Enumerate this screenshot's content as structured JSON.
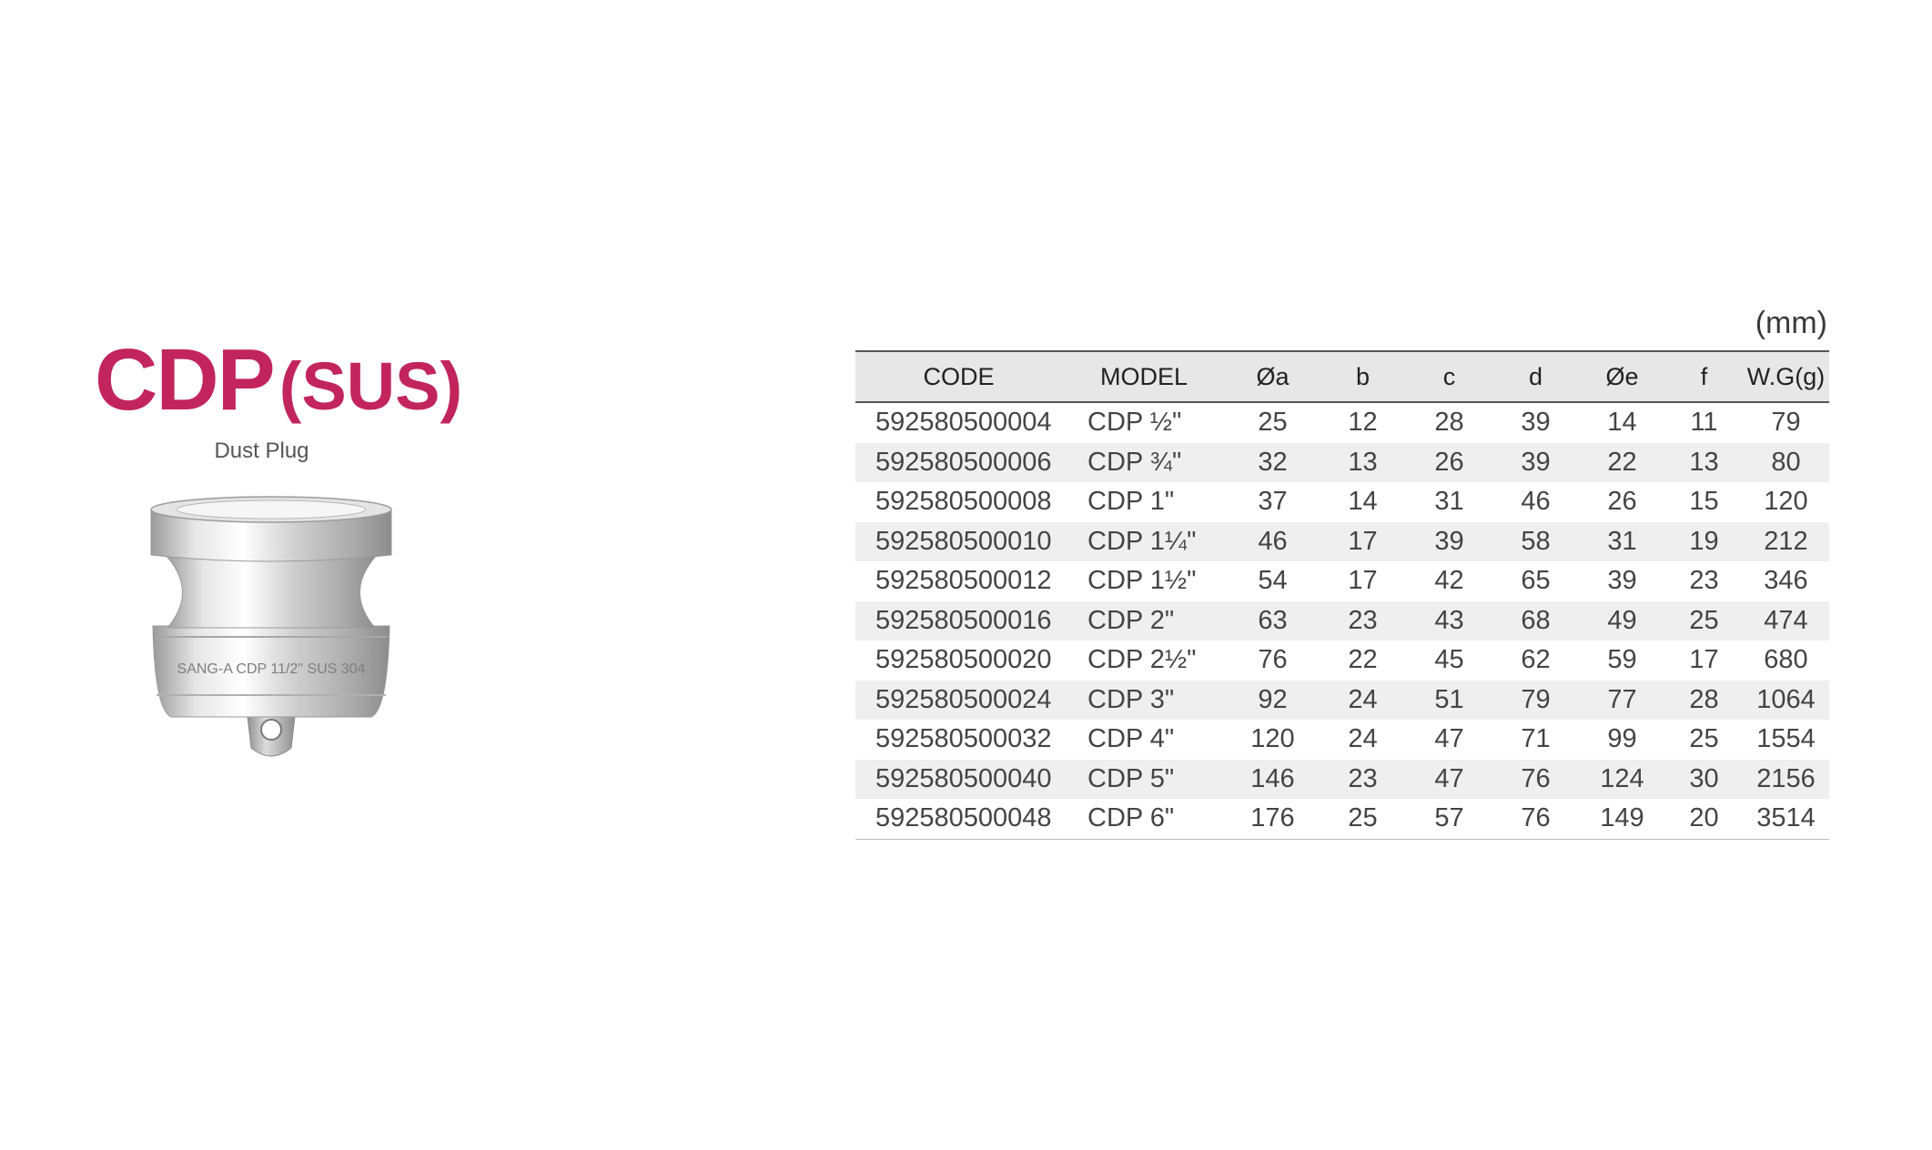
{
  "product": {
    "title_main": "CDP",
    "title_sub": "(SUS)",
    "subtitle": "Dust Plug",
    "image_icon": "stainless-dust-plug-image",
    "image_engraving": "SANG-A CDP 11/2\" SUS 304",
    "accent_color": "#c2255c"
  },
  "table": {
    "unit": "(mm)",
    "headers": [
      "CODE",
      "MODEL",
      "Øa",
      "b",
      "c",
      "d",
      "Øe",
      "f",
      "W.G(g)"
    ],
    "rows": [
      [
        "592580500004",
        "CDP ½\"",
        "25",
        "12",
        "28",
        "39",
        "14",
        "11",
        "79"
      ],
      [
        "592580500006",
        "CDP ¾\"",
        "32",
        "13",
        "26",
        "39",
        "22",
        "13",
        "80"
      ],
      [
        "592580500008",
        "CDP 1\"",
        "37",
        "14",
        "31",
        "46",
        "26",
        "15",
        "120"
      ],
      [
        "592580500010",
        "CDP 1¼\"",
        "46",
        "17",
        "39",
        "58",
        "31",
        "19",
        "212"
      ],
      [
        "592580500012",
        "CDP 1½\"",
        "54",
        "17",
        "42",
        "65",
        "39",
        "23",
        "346"
      ],
      [
        "592580500016",
        "CDP 2\"",
        "63",
        "23",
        "43",
        "68",
        "49",
        "25",
        "474"
      ],
      [
        "592580500020",
        "CDP 2½\"",
        "76",
        "22",
        "45",
        "62",
        "59",
        "17",
        "680"
      ],
      [
        "592580500024",
        "CDP 3\"",
        "92",
        "24",
        "51",
        "79",
        "77",
        "28",
        "1064"
      ],
      [
        "592580500032",
        "CDP 4\"",
        "120",
        "24",
        "47",
        "71",
        "99",
        "25",
        "1554"
      ],
      [
        "592580500040",
        "CDP 5\"",
        "146",
        "23",
        "47",
        "76",
        "124",
        "30",
        "2156"
      ],
      [
        "592580500048",
        "CDP 6\"",
        "176",
        "25",
        "57",
        "76",
        "149",
        "20",
        "3514"
      ]
    ]
  }
}
